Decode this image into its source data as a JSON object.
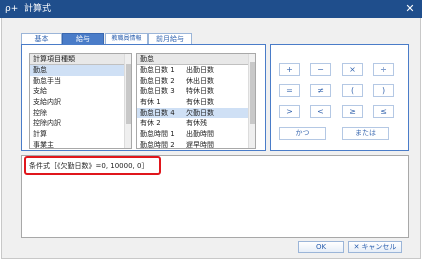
{
  "window": {
    "title": "計算式",
    "icon_text": "ρ+",
    "close_glyph": "✕"
  },
  "tabs": [
    {
      "label": "基本",
      "active": false
    },
    {
      "label": "給与",
      "active": true
    },
    {
      "label": "教職員情報",
      "active": false
    },
    {
      "label": "前月給与",
      "active": false
    }
  ],
  "left_list": {
    "header": "計算項目種類",
    "items": [
      "勤怠",
      "勤怠手当",
      "支給",
      "支給内訳",
      "控除",
      "控除内訳",
      "計算",
      "事業主"
    ],
    "selected_index": 0
  },
  "right_list": {
    "header": "勤怠",
    "items": [
      {
        "code": "勤怠日数 1",
        "name": "出勤日数"
      },
      {
        "code": "勤怠日数 2",
        "name": "休出日数"
      },
      {
        "code": "勤怠日数 3",
        "name": "特休日数"
      },
      {
        "code": "有休 1",
        "name": "有休日数"
      },
      {
        "code": "勤怠日数 4",
        "name": "欠勤日数"
      },
      {
        "code": "有休 2",
        "name": "有休残"
      },
      {
        "code": "勤怠時間 1",
        "name": "出勤時間"
      },
      {
        "code": "勤怠時間 2",
        "name": "遅早時間"
      }
    ],
    "selected_index": 4
  },
  "operators": {
    "row1": [
      "+",
      "−",
      "×",
      "÷"
    ],
    "row2": [
      "=",
      "≠",
      "(",
      ")"
    ],
    "row3": [
      ">",
      "<",
      "≥",
      "≤"
    ],
    "and_label": "かつ",
    "or_label": "または"
  },
  "formula": {
    "text": "条件式［《欠勤日数》=0, 10000, 0］"
  },
  "buttons": {
    "ok": "OK",
    "cancel_icon": "✕",
    "cancel": "キャンセル"
  },
  "colors": {
    "titlebar": "#1f4e8c",
    "accent": "#4a7cc8",
    "highlight": "#e0161c"
  }
}
